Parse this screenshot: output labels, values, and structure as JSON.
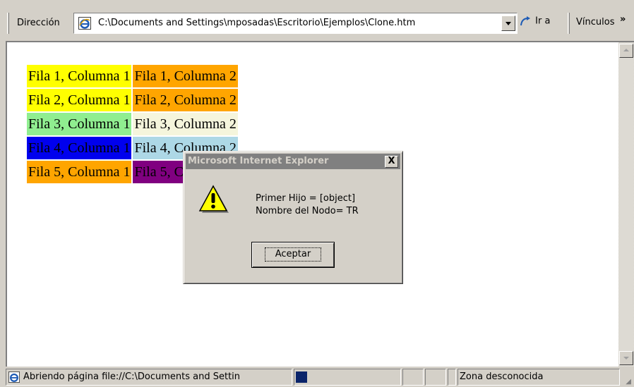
{
  "addressbar": {
    "label": "Dirección",
    "url": "C:\\Documents and Settings\\mposadas\\Escritorio\\Ejemplos\\Clone.htm",
    "go_label": "Ir a",
    "links_label": "Vínculos",
    "chevron": "»"
  },
  "table": {
    "rows": [
      {
        "c1": "Fila 1, Columna 1",
        "c2": "Fila 1, Columna 2",
        "bg1": "#ffff00",
        "bg2": "#ffa500",
        "fg1": "#000000",
        "fg2": "#000000"
      },
      {
        "c1": "Fila 2, Columna 1",
        "c2": "Fila 2, Columna 2",
        "bg1": "#ffff00",
        "bg2": "#ffa500",
        "fg1": "#000000",
        "fg2": "#000000"
      },
      {
        "c1": "Fila 3, Columna 1",
        "c2": "Fila 3, Columna 2",
        "bg1": "#90ee90",
        "bg2": "#f5f5dc",
        "fg1": "#000000",
        "fg2": "#000000"
      },
      {
        "c1": "Fila 4, Columna 1",
        "c2": "Fila 4, Columna 2",
        "bg1": "#0000ee",
        "bg2": "#add8e6",
        "fg1": "#000000",
        "fg2": "#000000"
      },
      {
        "c1": "Fila 5, Columna 1",
        "c2": "Fila 5, Columna 2",
        "bg1": "#ffa500",
        "bg2": "#800080",
        "fg1": "#000000",
        "fg2": "#000000"
      }
    ]
  },
  "dialog": {
    "title": "Microsoft Internet Explorer",
    "close_label": "X",
    "line1": "Primer Hijo = [object]",
    "line2": "Nombre del Nodo= TR",
    "ok_label": "Aceptar",
    "icon": "warning-icon"
  },
  "statusbar": {
    "loading_text": "Abriendo página file://C:\\Documents and Settin",
    "zone_text": "Zona desconocida"
  }
}
